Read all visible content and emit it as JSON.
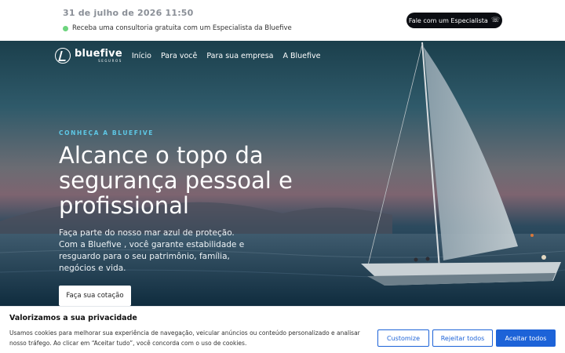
{
  "topbar": {
    "datetime": "31 de julho de 2026 11:50",
    "promo_text": "Receba uma consultoria gratuita com um Especialista da Bluefive",
    "cta_label": "Fale com um Especialista",
    "cta_icon": "headset-icon"
  },
  "nav": {
    "logo_name": "bluefive",
    "logo_sub": "SEGUROS",
    "links": [
      "Início",
      "Para você",
      "Para sua empresa",
      "A Bluefive"
    ]
  },
  "hero": {
    "eyebrow": "CONHEÇA A BLUEFIVE",
    "headline": "Alcance o topo da segurança pessoal e profissional",
    "subtext": "Faça parte do nosso mar azul de proteção. Com a Bluefive , você garante estabilidade e resguardo para o seu patrimônio, família, negócios e vida.",
    "button_label": "Faça sua cotação"
  },
  "cookie": {
    "title": "Valorizamos a sua privacidade",
    "text": "Usamos cookies para melhorar sua experiência de navegação, veicular anúncios ou conteúdo personalizado e analisar nosso tráfego. Ao clicar em “Aceitar tudo”, você concorda com o uso de cookies.",
    "customize_label": "Customize",
    "reject_label": "Rejeitar todos",
    "accept_label": "Aceitar todos"
  },
  "colors": {
    "accent": "#1d63d8",
    "eyebrow": "#5ec8e6",
    "status_dot": "#6dd47e"
  }
}
